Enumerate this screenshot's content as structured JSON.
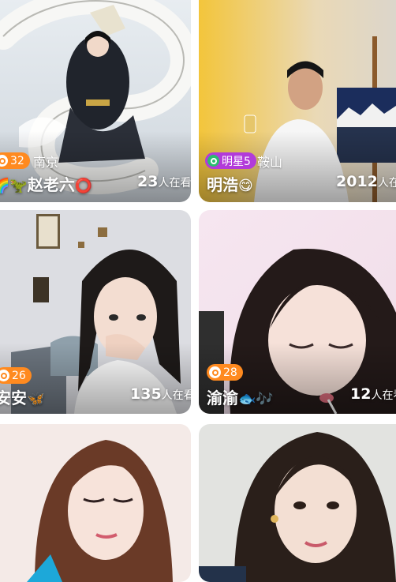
{
  "feed": {
    "cards": [
      {
        "level": "32",
        "city": "南京",
        "name_prefix": "🌈🦖",
        "name": "赵老六",
        "name_suffix": "⭕",
        "viewers": "23",
        "viewers_unit": "人在看"
      },
      {
        "level": "明星5",
        "city": "鞍山",
        "name": "明浩",
        "name_suffix": "😋",
        "viewers": "2012",
        "viewers_unit": "人在看"
      },
      {
        "level": "26",
        "name": "安安",
        "name_suffix": "🦋",
        "viewers": "135",
        "viewers_unit": "人在看"
      },
      {
        "level": "28",
        "name": "渝渝",
        "name_suffix": "🐟🎶",
        "viewers": "12",
        "viewers_unit": "人在看"
      },
      {},
      {}
    ]
  },
  "colors": {
    "badge_orange": "#ff8a1f",
    "badge_purple": "#b23bd9",
    "badge_green": "#2bbd6e"
  }
}
